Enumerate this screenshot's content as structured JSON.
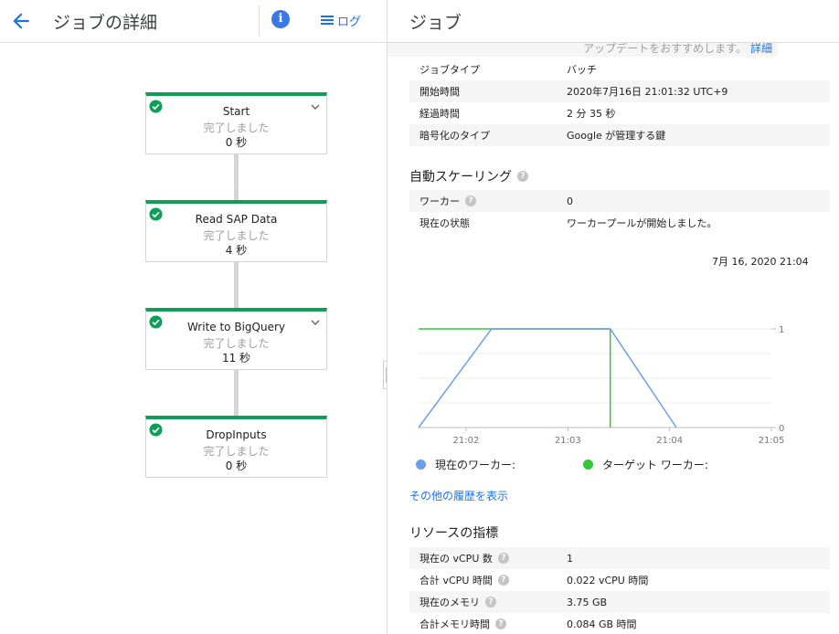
{
  "header": {
    "back_icon": "arrow-left-icon",
    "title": "ジョブの詳細",
    "log_label": "ログ",
    "panel_title": "ジョブ"
  },
  "graph": {
    "steps": [
      {
        "name": "Start",
        "status": "完了しました",
        "time": "0 秒",
        "expandable": true
      },
      {
        "name": "Read SAP Data",
        "status": "完了しました",
        "time": "4 秒",
        "expandable": false
      },
      {
        "name": "Write to BigQuery",
        "status": "完了しました",
        "time": "11 秒",
        "expandable": true
      },
      {
        "name": "DropInputs",
        "status": "完了しました",
        "time": "0 秒",
        "expandable": false
      }
    ]
  },
  "details": {
    "notice_text": "アップデートをおすすめします。",
    "notice_link": "詳細",
    "job_info": [
      {
        "label": "ジョブタイプ",
        "value": "バッチ"
      },
      {
        "label": "開始時間",
        "value": "2020年7月16日 21:01:32 UTC+9"
      },
      {
        "label": "経過時間",
        "value": "2 分 35 秒"
      },
      {
        "label": "暗号化のタイプ",
        "value": "Google が管理する鍵"
      }
    ],
    "autoscaling": {
      "title": "自動スケーリング",
      "rows": [
        {
          "label": "ワーカー",
          "value": "0"
        },
        {
          "label": "現在の状態",
          "value": "ワーカープールが開始しました。"
        }
      ],
      "chart_timestamp": "7月 16, 2020 21:04",
      "more_history": "その他の履歴を表示"
    },
    "resources": {
      "title": "リソースの指標",
      "rows": [
        {
          "label": "現在の vCPU 数",
          "value": "1"
        },
        {
          "label": "合計 vCPU 時間",
          "value": "0.022 vCPU 時間"
        },
        {
          "label": "現在のメモリ",
          "value": "3.75 GB"
        },
        {
          "label": "合計メモリ時間",
          "value": "0.084 GB 時間"
        }
      ]
    }
  },
  "chart_data": {
    "type": "line",
    "x_ticks": [
      "21:02",
      "21:03",
      "21:04",
      "21:05"
    ],
    "y_ticks": [
      "0",
      "1"
    ],
    "ylim": [
      0,
      1
    ],
    "series": [
      {
        "name": "現在のワーカー:",
        "color": "#6d9eeb",
        "points": [
          [
            "21:01:32",
            0
          ],
          [
            "21:02:15",
            1
          ],
          [
            "21:03:25",
            1
          ],
          [
            "21:04:04",
            0
          ]
        ]
      },
      {
        "name": "ターゲット ワーカー:",
        "color": "#34c73b",
        "points": [
          [
            "21:01:32",
            1
          ],
          [
            "21:03:25",
            1
          ],
          [
            "21:03:25",
            0
          ]
        ]
      }
    ]
  }
}
